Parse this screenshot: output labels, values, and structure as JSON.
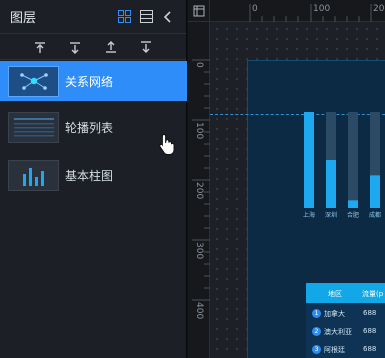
{
  "panel": {
    "title": "图层",
    "layers": [
      {
        "label": "关系网络",
        "active": true,
        "icon": "network-graph-icon"
      },
      {
        "label": "轮播列表",
        "active": false,
        "icon": "carousel-list-icon"
      },
      {
        "label": "基本柱图",
        "active": false,
        "icon": "bar-chart-icon"
      }
    ]
  },
  "toolbar": {
    "buttons": [
      "move-up",
      "move-down",
      "move-to-top",
      "move-to-bottom"
    ]
  },
  "rulers": {
    "top": [
      "0",
      "100",
      "200"
    ],
    "left": [
      "0",
      "100",
      "200",
      "300",
      "400"
    ]
  },
  "chart_data": {
    "type": "bar",
    "categories": [
      "上海",
      "深圳",
      "合肥",
      "成都"
    ],
    "values": [
      1.0,
      0.5,
      0.08,
      0.34
    ],
    "background_values": [
      1.0,
      1.0,
      1.0,
      1.0
    ],
    "title": "",
    "xlabel": "",
    "ylabel": "",
    "ylim": [
      0,
      1
    ],
    "colors": {
      "bar": "#1ea8f0",
      "bar_bg": "#2a4a66"
    }
  },
  "table": {
    "headers": [
      "地区",
      "流量(p"
    ],
    "rows": [
      {
        "rank": "1",
        "name": "加拿大",
        "value": "688"
      },
      {
        "rank": "2",
        "name": "澳大利亚",
        "value": "688"
      },
      {
        "rank": "3",
        "name": "阿根廷",
        "value": "688"
      }
    ]
  },
  "colors": {
    "accent": "#2e8df8",
    "panel_bg": "#1c1f25",
    "canvas_bg": "#1d2127",
    "screen_bg": "#0d2a44"
  }
}
